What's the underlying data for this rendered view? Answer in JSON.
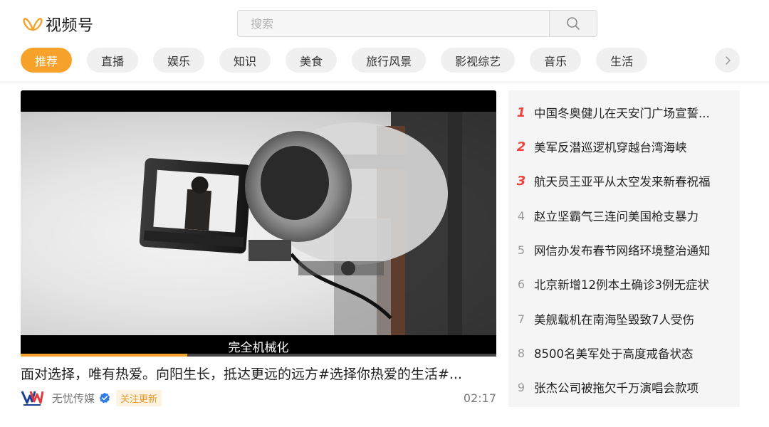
{
  "app": {
    "logo_text": "视频号"
  },
  "search": {
    "placeholder": "搜索"
  },
  "categories": [
    "推荐",
    "直播",
    "娱乐",
    "知识",
    "美食",
    "旅行风景",
    "影视综艺",
    "音乐",
    "生活"
  ],
  "active_category": "推荐",
  "video": {
    "subtitle": "完全机械化",
    "title": "面对选择，唯有热爱。向阳生长，抵达更远的远方#选择你热爱的生活#...",
    "author": "无忧传媒",
    "follow_label": "关注更新",
    "duration": "02:17",
    "progress": 0.35
  },
  "hot_list": [
    {
      "rank": "1",
      "text": "中国冬奥健儿在天安门广场宣誓..."
    },
    {
      "rank": "2",
      "text": "美军反潜巡逻机穿越台湾海峡"
    },
    {
      "rank": "3",
      "text": "航天员王亚平从太空发来新春祝福"
    },
    {
      "rank": "4",
      "text": "赵立坚霸气三连问美国枪支暴力"
    },
    {
      "rank": "5",
      "text": "网信办发布春节网络环境整治通知"
    },
    {
      "rank": "6",
      "text": "北京新增12例本土确诊3例无症状"
    },
    {
      "rank": "7",
      "text": "美舰载机在南海坠毁致7人受伤"
    },
    {
      "rank": "8",
      "text": "8500名美军处于高度戒备状态"
    },
    {
      "rank": "9",
      "text": "张杰公司被拖欠千万演唱会款项"
    }
  ],
  "colors": {
    "accent": "#f6a22b",
    "top_rank": "#f0433f",
    "verified": "#2f7be8"
  },
  "icons": {
    "logo": "butterfly-logo-icon",
    "search": "search-icon",
    "more": "chevron-right-icon",
    "verified": "verified-badge-icon"
  }
}
